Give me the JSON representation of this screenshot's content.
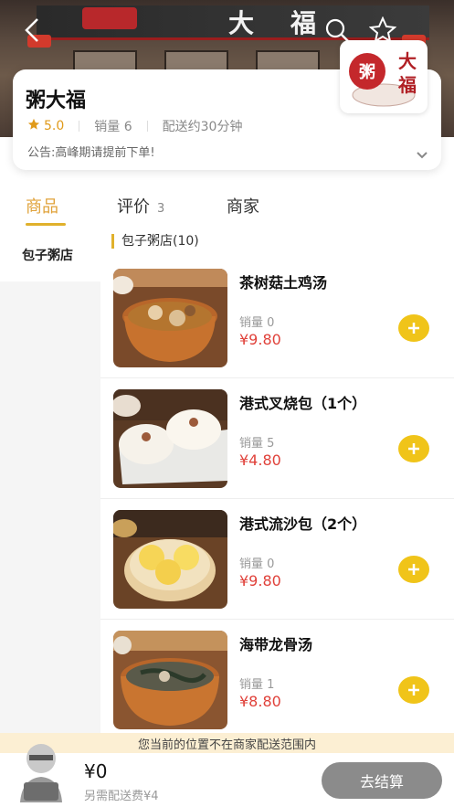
{
  "header": {
    "sign_text": "大福",
    "icons": {
      "back": "back-arrow-icon",
      "search": "search-icon",
      "favorite": "star-icon"
    }
  },
  "store": {
    "name": "粥大福",
    "rating": "5.0",
    "sales": "销量 6",
    "delivery_time": "配送约30分钟",
    "notice": "公告:高峰期请提前下单!",
    "logo_text_char1": "粥",
    "logo_text_char2": "大",
    "logo_text_char3": "福"
  },
  "tabs": [
    {
      "label": "商品",
      "active": true
    },
    {
      "label": "评价",
      "count": "3"
    },
    {
      "label": "商家"
    }
  ],
  "sidebar": {
    "items": [
      {
        "label": "包子粥店"
      }
    ]
  },
  "section": {
    "title": "包子粥店(10)"
  },
  "products": [
    {
      "name": "茶树菇土鸡汤",
      "sales": "销量 0",
      "price": "¥9.80"
    },
    {
      "name": "港式叉烧包（1个）",
      "sales": "销量 5",
      "price": "¥4.80"
    },
    {
      "name": "港式流沙包（2个）",
      "sales": "销量 0",
      "price": "¥9.80"
    },
    {
      "name": "海带龙骨汤",
      "sales": "销量 1",
      "price": "¥8.80"
    }
  ],
  "warning": "您当前的位置不在商家配送范围内",
  "cart": {
    "total": "¥0",
    "delivery_fee_note": "另需配送费¥4",
    "checkout_label": "去结算"
  },
  "colors": {
    "accent": "#e0b12c",
    "add_button": "#f0c419",
    "price": "#e0413a",
    "checkout_disabled": "#8b8b8b"
  }
}
